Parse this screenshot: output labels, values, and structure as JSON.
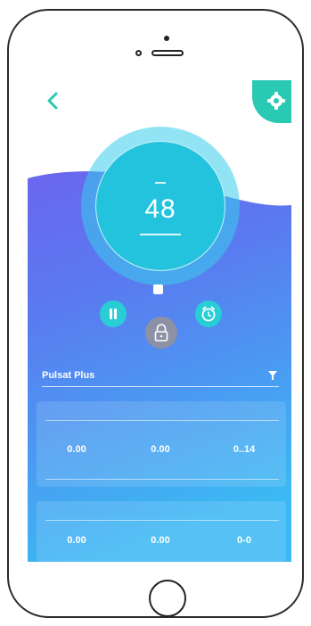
{
  "screen": {
    "colors": {
      "accent": "#29c9b4",
      "ring": "#24c3dd",
      "wave_top": "#5f6df0",
      "wave_bottom": "#41b4f2"
    },
    "dial": {
      "value": "48",
      "unit": ""
    },
    "program_title": "Pulsat Plus",
    "cards": [
      {
        "header": "",
        "stats": [
          {
            "value": "0.00",
            "unit": "",
            "label": ""
          },
          {
            "value": "0.00",
            "unit": "",
            "label": ""
          },
          {
            "value": "0..14",
            "unit": "",
            "label": ""
          }
        ]
      },
      {
        "header": "",
        "stats": [
          {
            "value": "0.00",
            "unit": "",
            "label": ""
          },
          {
            "value": "0.00",
            "unit": "",
            "label": ""
          },
          {
            "value": "0-0",
            "unit": "",
            "label": ""
          }
        ]
      }
    ],
    "icons": [
      "back-arrow-icon",
      "settings-gear-icon",
      "pause-icon",
      "alarm-clock-icon",
      "lock-icon",
      "filter-icon"
    ]
  }
}
